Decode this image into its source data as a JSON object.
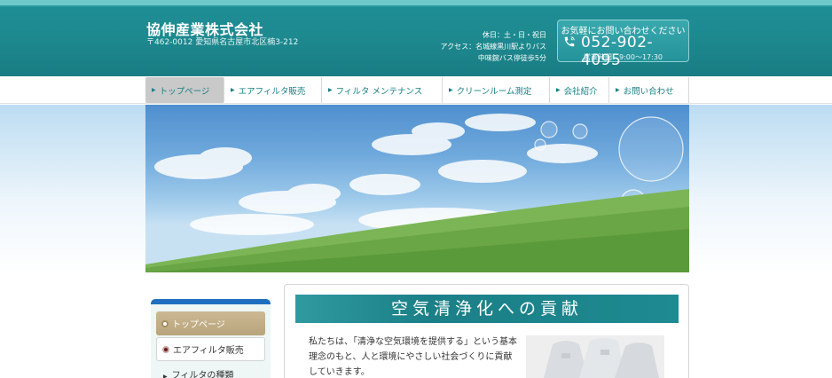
{
  "header": {
    "company_name": "協伸産業株式会社",
    "address": "〒462-0012 愛知県名古屋市北区楠3-212",
    "holiday": "休日：土・日・祝日",
    "access_line1": "アクセス：名城線黒川駅よりバス",
    "access_line2": "中味鋺バス停徒歩5分",
    "contact": {
      "caption": "お気軽にお問い合わせください",
      "phone_icon": "phone-icon",
      "phone": "052-902-4095",
      "hours": "営業時間：9:00〜17:30"
    }
  },
  "nav": {
    "items": [
      {
        "label": "トップページ"
      },
      {
        "label": "エアフィルタ販売"
      },
      {
        "label": "フィルタ メンテナンス"
      },
      {
        "label": "クリーンルーム測定"
      },
      {
        "label": "会社紹介"
      },
      {
        "label": "お問い合わせ"
      }
    ]
  },
  "sidebar": {
    "items": [
      {
        "label": "トップページ"
      },
      {
        "label": "エアフィルタ販売"
      }
    ],
    "sub_items": [
      {
        "label": "フィルタの種類"
      }
    ]
  },
  "main": {
    "heading": "空気清浄化への貢献",
    "intro": "私たちは、「清浄な空気環境を提供する」という基本理念のもと、人と環境にやさしい社会づくりに貢献していきます。"
  },
  "colors": {
    "header_teal": "#1d8a90",
    "nav_text": "#177f86",
    "sidebar_active": "#c3b08a",
    "sidebar_top": "#1f6fbf"
  }
}
